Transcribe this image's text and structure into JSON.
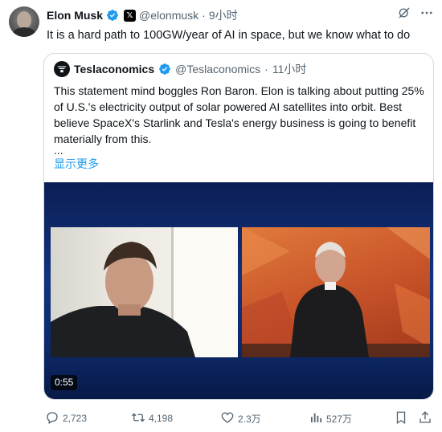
{
  "author": {
    "name": "Elon Musk",
    "handle": "@elonmusk",
    "separator": "·",
    "time": "9小时",
    "affiliate_badge": "𝕏"
  },
  "tweet_text": "It is a hard path to 100GW/year of AI in space, but we know what to do",
  "quoted": {
    "name": "Teslaconomics",
    "handle": "@Teslaconomics",
    "separator": "·",
    "time": "11小时",
    "text": "This statement mind boggles Ron Baron. Elon is talking about putting 25% of U.S.'s electricity output of solar powered AI satellites into orbit. Best believe SpaceX's Starlink and Tesla's energy business is going to benefit materially from this.",
    "ellipsis": "...",
    "show_more": "显示更多",
    "video_duration": "0:55"
  },
  "actions": {
    "replies": "2,723",
    "reposts": "4,198",
    "likes": "2.3万",
    "views": "527万"
  },
  "colors": {
    "verified": "#1d9bf0",
    "link": "#1d9bf0",
    "secondary_text": "#536471"
  },
  "icons": [
    "verified-icon",
    "x-affiliate-icon",
    "grok-icon",
    "more-icon",
    "reply-icon",
    "repost-icon",
    "like-icon",
    "views-icon",
    "bookmark-icon",
    "share-icon"
  ]
}
